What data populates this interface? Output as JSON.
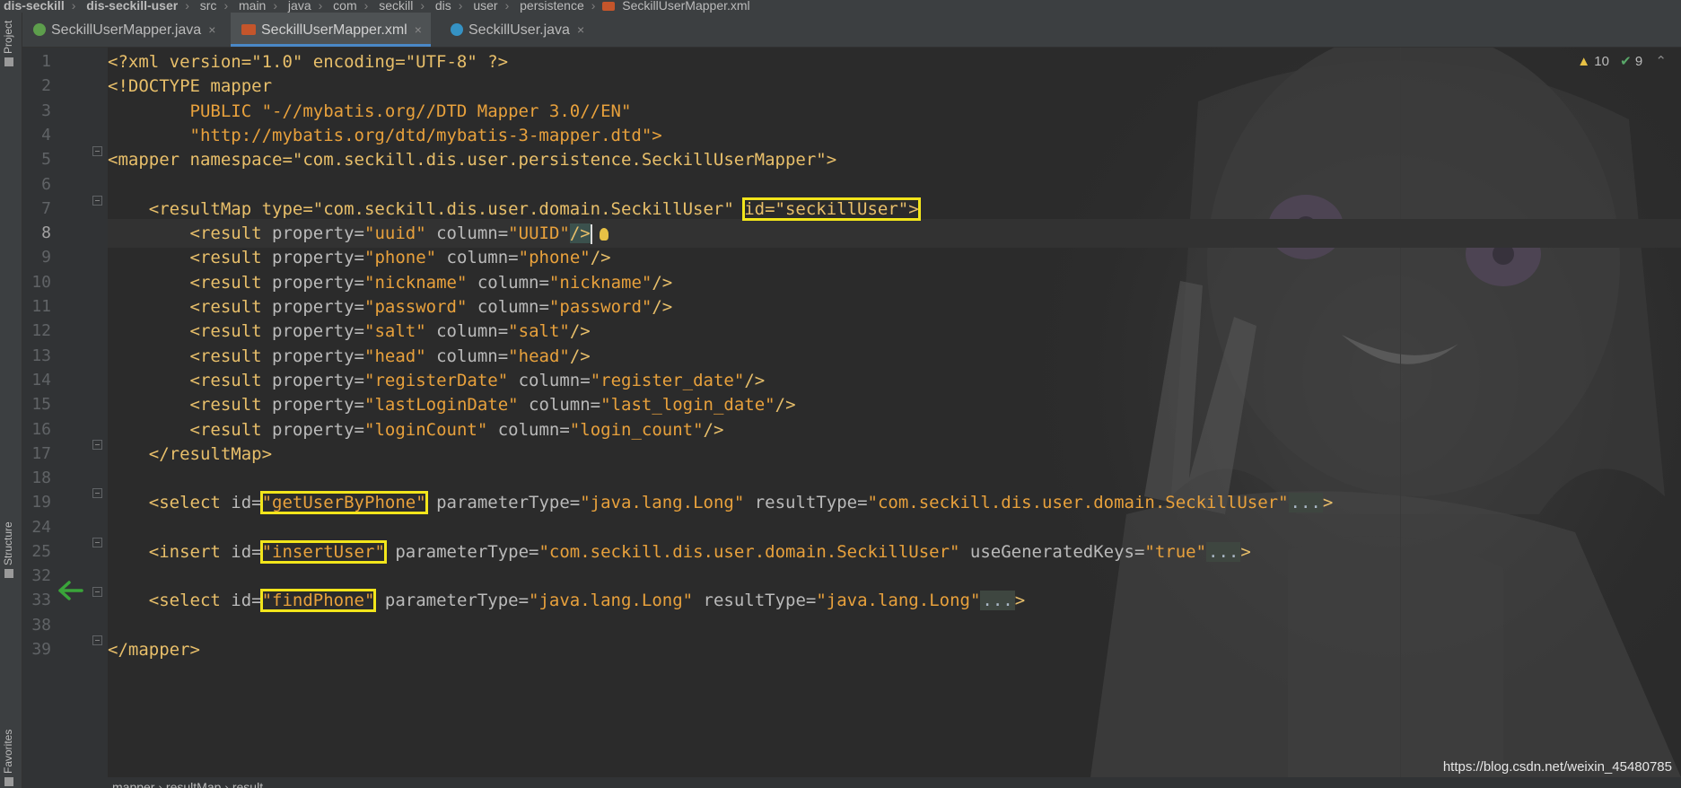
{
  "breadcrumb": {
    "items": [
      "dis-seckill",
      "dis-seckill-user",
      "src",
      "main",
      "java",
      "com",
      "seckill",
      "dis",
      "user",
      "persistence",
      "SeckillUserMapper.xml"
    ]
  },
  "tool_windows": {
    "project": "Project",
    "structure": "Structure",
    "favorites": "Favorites"
  },
  "tabs": [
    {
      "label": "SeckillUserMapper.java",
      "icon": "interface-icon",
      "close": "×"
    },
    {
      "label": "SeckillUserMapper.xml",
      "icon": "xml-file-icon",
      "close": "×"
    },
    {
      "label": "SeckillUser.java",
      "icon": "class-icon",
      "close": "×"
    }
  ],
  "inspections": {
    "warnings": "10",
    "weak_warnings": "9"
  },
  "line_numbers": [
    "1",
    "2",
    "3",
    "4",
    "5",
    "6",
    "7",
    "8",
    "9",
    "10",
    "11",
    "12",
    "13",
    "14",
    "15",
    "16",
    "17",
    "18",
    "19",
    "24",
    "25",
    "32",
    "33",
    "38",
    "39"
  ],
  "code": {
    "l1": "<?xml version=\"1.0\" encoding=\"UTF-8\" ?>",
    "l2": "<!DOCTYPE mapper",
    "l3": "        PUBLIC \"-//mybatis.org//DTD Mapper 3.0//EN\"",
    "l4": "        \"http://mybatis.org/dtd/mybatis-3-mapper.dtd\">",
    "l5": "<mapper namespace=\"com.seckill.dis.user.persistence.SeckillUserMapper\">",
    "l7a": "    <resultMap type=\"com.seckill.dis.user.domain.SeckillUser\" ",
    "l7b": "id=\"seckillUser\">",
    "results": [
      {
        "property": "uuid",
        "column": "UUID"
      },
      {
        "property": "phone",
        "column": "phone"
      },
      {
        "property": "nickname",
        "column": "nickname"
      },
      {
        "property": "password",
        "column": "password"
      },
      {
        "property": "salt",
        "column": "salt"
      },
      {
        "property": "head",
        "column": "head"
      },
      {
        "property": "registerDate",
        "column": "register_date"
      },
      {
        "property": "lastLoginDate",
        "column": "last_login_date"
      },
      {
        "property": "loginCount",
        "column": "login_count"
      }
    ],
    "l17": "    </resultMap>",
    "l19": {
      "id": "\"getUserByPhone\"",
      "parameterType": "\"java.lang.Long\"",
      "resultType": "\"com.seckill.dis.user.domain.SeckillUser\""
    },
    "l25": {
      "id": "\"insertUser\"",
      "parameterType": "\"com.seckill.dis.user.domain.SeckillUser\"",
      "useGeneratedKeys": "\"true\""
    },
    "l33": {
      "id": "\"findPhone\"",
      "parameterType": "\"java.lang.Long\"",
      "resultType": "\"java.lang.Long\""
    },
    "l39": "</mapper>",
    "ellipsis": "..."
  },
  "bottom_breadcrumb": [
    "mapper",
    "resultMap",
    "result"
  ],
  "watermark": "https://blog.csdn.net/weixin_45480785",
  "colors": {
    "highlight_box": "#f2e51b",
    "tag": "#e8bf6a",
    "string": "#e8a13c",
    "background": "#2b2b2b"
  }
}
